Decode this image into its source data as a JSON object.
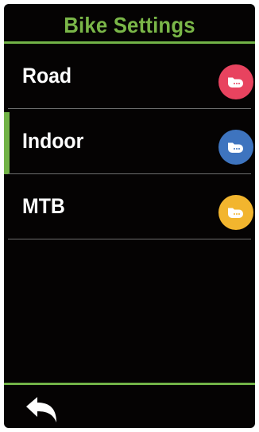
{
  "header": {
    "title": "Bike Settings"
  },
  "bikes": [
    {
      "label": "Road",
      "icon": "bike-profile-icon",
      "color": "#e8435f",
      "selected": false
    },
    {
      "label": "Indoor",
      "icon": "bike-profile-icon",
      "color": "#3e74bf",
      "selected": true
    },
    {
      "label": "MTB",
      "icon": "bike-profile-icon",
      "color": "#f2b52e",
      "selected": false
    }
  ],
  "footer": {
    "back_icon": "back-arrow-icon"
  },
  "colors": {
    "accent": "#72b347",
    "background": "#050303"
  }
}
